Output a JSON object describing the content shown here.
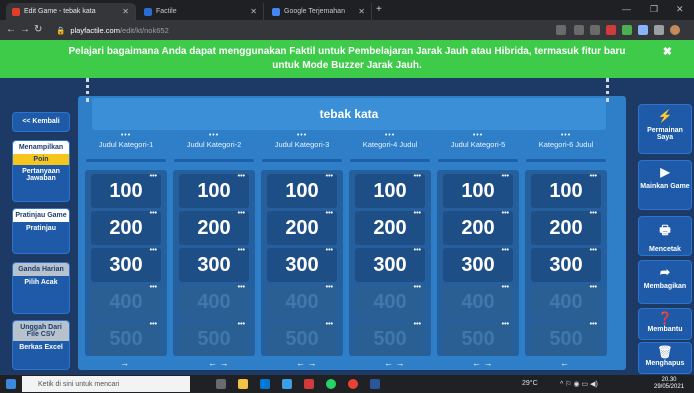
{
  "browser": {
    "tabs": [
      {
        "label": "Edit Game - tebak kata",
        "color": "#e23c2e"
      },
      {
        "label": "Factile",
        "color": "#2b6cd4"
      },
      {
        "label": "Google Terjemahan",
        "color": "#4285f4"
      }
    ],
    "url_host": "playfactile.com",
    "url_path": "/edit/kt/nok652"
  },
  "banner": {
    "text": "Pelajari bagaimana Anda dapat menggunakan Faktil untuk Pembelajaran Jarak Jauh atau Hibrida, termasuk fitur baru untuk Mode Buzzer Jarak Jauh.",
    "close": "✖"
  },
  "left_sidebar": {
    "back": "<< Kembali",
    "show_label": "Menampilkan",
    "show_value": "Poin",
    "show_sub": "Pertanyaan Jawaban",
    "preview_label": "Pratinjau Game",
    "preview_sub": "Pratinjau",
    "double_label": "Ganda Harian",
    "double_sub": "Pilih Acak",
    "upload_label": "Unggah Dari File CSV",
    "upload_sub": "Berkas Excel"
  },
  "right_sidebar": {
    "play_mine": "Permainan Saya",
    "play_game": "Mainkan Game",
    "print": "Mencetak",
    "share": "Membagikan",
    "help": "Membantu",
    "delete": "Menghapus"
  },
  "board": {
    "title": "tebak kata",
    "menu_dots": "•••",
    "categories": [
      "Judul Kategori-1",
      "Judul Kategori-2",
      "Judul Kategori-3",
      "Kategori-4 Judul",
      "Judul Kategori-5",
      "Kategori-6 Judul"
    ],
    "values": [
      "100",
      "200",
      "300",
      "400",
      "500"
    ],
    "active_rows": 3,
    "column_arrows": [
      "→",
      "← →",
      "← →",
      "← →",
      "← →",
      "←"
    ]
  },
  "taskbar": {
    "search_placeholder": "Ketik di sini untuk mencari",
    "weather": "29°C",
    "time": "20.30",
    "date": "29/05/2021"
  }
}
